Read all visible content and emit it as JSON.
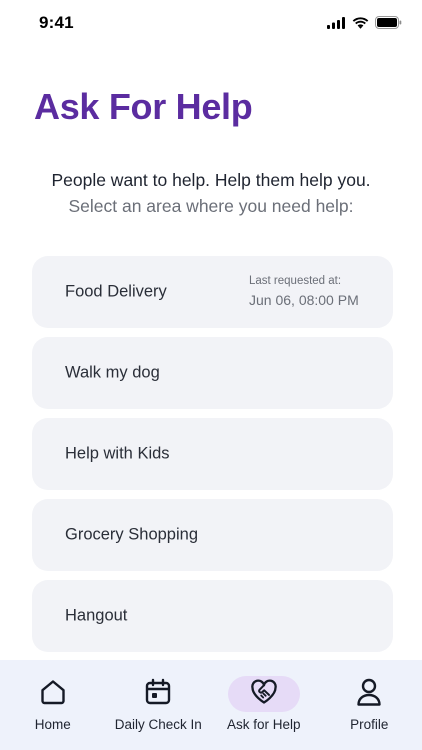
{
  "status_bar": {
    "time": "9:41"
  },
  "header": {
    "title": "Ask For Help",
    "subtitle": "People want to help. Help them help you.",
    "prompt": "Select an area where you need help:"
  },
  "help_options": [
    {
      "label": "Food Delivery",
      "meta_caption": "Last requested at:",
      "meta_value": "Jun 06, 08:00 PM"
    },
    {
      "label": "Walk my dog"
    },
    {
      "label": "Help with Kids"
    },
    {
      "label": "Grocery Shopping"
    },
    {
      "label": "Hangout"
    }
  ],
  "bottom_nav": {
    "items": [
      {
        "label": "Home",
        "icon": "home-icon"
      },
      {
        "label": "Daily Check In",
        "icon": "calendar-icon"
      },
      {
        "label": "Ask for Help",
        "icon": "heart-handshake-icon",
        "active": true
      },
      {
        "label": "Profile",
        "icon": "person-icon"
      }
    ]
  },
  "colors": {
    "accent": "#5b2ca0",
    "card_bg": "#f2f3f7",
    "nav_bg": "#eef2fb",
    "nav_active_pill": "#e6dbf7"
  }
}
